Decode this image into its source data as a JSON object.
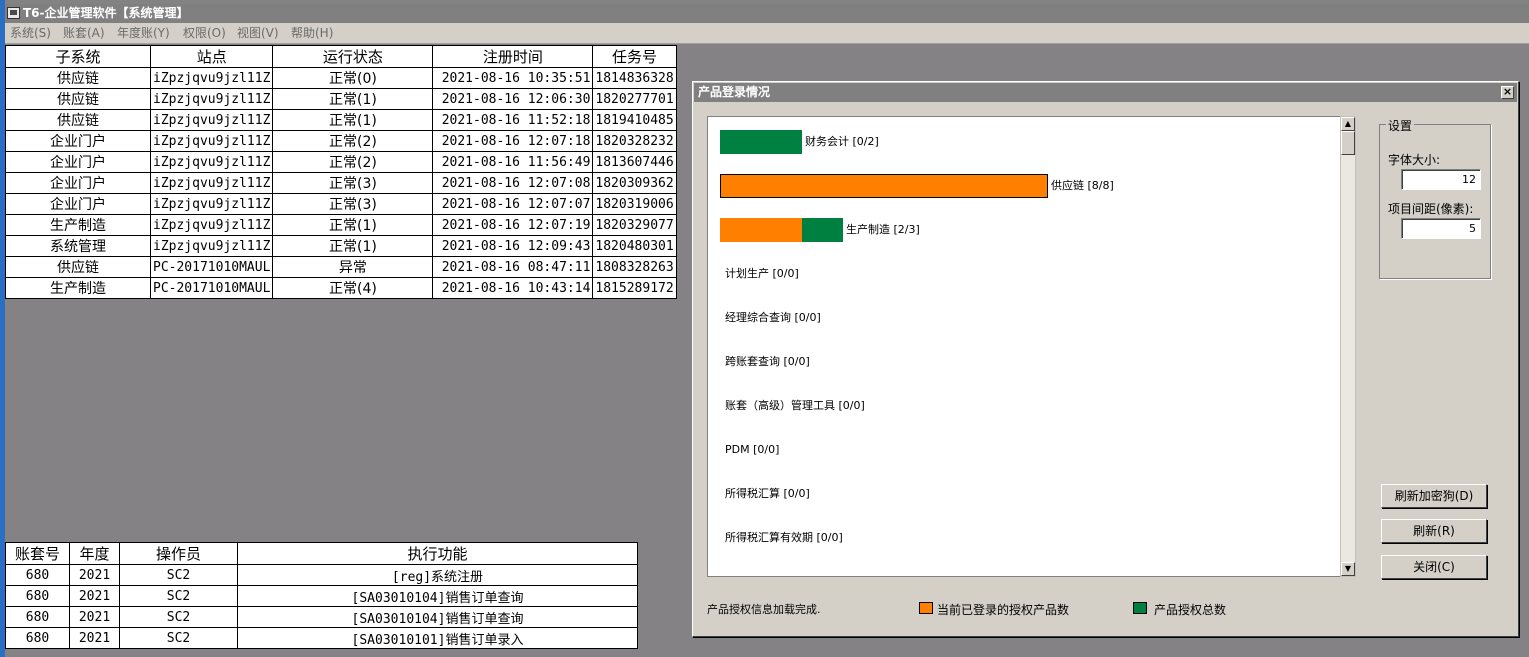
{
  "window": {
    "title": "T6-企业管理软件【系统管理】"
  },
  "menu": [
    "系统(S)",
    "账套(A)",
    "年度账(Y)",
    "权限(O)",
    "视图(V)",
    "帮助(H)"
  ],
  "top_grid": {
    "headers": [
      "子系统",
      "站点",
      "运行状态",
      "注册时间",
      "任务号"
    ],
    "rows": [
      [
        "供应链",
        "iZpzjqvu9jzl11Z",
        "正常(0)",
        "2021-08-16 10:35:51",
        "1814836328"
      ],
      [
        "供应链",
        "iZpzjqvu9jzl11Z",
        "正常(1)",
        "2021-08-16 12:06:30",
        "1820277701"
      ],
      [
        "供应链",
        "iZpzjqvu9jzl11Z",
        "正常(1)",
        "2021-08-16 11:52:18",
        "1819410485"
      ],
      [
        "企业门户",
        "iZpzjqvu9jzl11Z",
        "正常(2)",
        "2021-08-16 12:07:18",
        "1820328232"
      ],
      [
        "企业门户",
        "iZpzjqvu9jzl11Z",
        "正常(2)",
        "2021-08-16 11:56:49",
        "1813607446"
      ],
      [
        "企业门户",
        "iZpzjqvu9jzl11Z",
        "正常(3)",
        "2021-08-16 12:07:08",
        "1820309362"
      ],
      [
        "企业门户",
        "iZpzjqvu9jzl11Z",
        "正常(3)",
        "2021-08-16 12:07:07",
        "1820319006"
      ],
      [
        "生产制造",
        "iZpzjqvu9jzl11Z",
        "正常(1)",
        "2021-08-16 12:07:19",
        "1820329077"
      ],
      [
        "系统管理",
        "iZpzjqvu9jzl11Z",
        "正常(1)",
        "2021-08-16 12:09:43",
        "1820480301"
      ],
      [
        "供应链",
        "PC-20171010MAUL",
        "异常",
        "2021-08-16 08:47:11",
        "1808328263"
      ],
      [
        "生产制造",
        "PC-20171010MAUL",
        "正常(4)",
        "2021-08-16 10:43:14",
        "1815289172"
      ]
    ]
  },
  "bottom_grid": {
    "headers": [
      "账套号",
      "年度",
      "操作员",
      "执行功能"
    ],
    "rows": [
      [
        "680",
        "2021",
        "SC2",
        "[reg]系统注册"
      ],
      [
        "680",
        "2021",
        "SC2",
        "[SA03010104]销售订单查询"
      ],
      [
        "680",
        "2021",
        "SC2",
        "[SA03010104]销售订单查询"
      ],
      [
        "680",
        "2021",
        "SC2",
        "[SA03010101]销售订单录入"
      ]
    ]
  },
  "dialog": {
    "title": "产品登录情况",
    "close_icon": "close-icon",
    "items": [
      {
        "label": "财务会计 [0/2]",
        "logged": 0,
        "total": 2
      },
      {
        "label": "供应链 [8/8]",
        "logged": 8,
        "total": 8
      },
      {
        "label": "生产制造 [2/3]",
        "logged": 2,
        "total": 3
      },
      {
        "label": "计划生产 [0/0]",
        "logged": 0,
        "total": 0
      },
      {
        "label": "经理综合查询 [0/0]",
        "logged": 0,
        "total": 0
      },
      {
        "label": "跨账套查询 [0/0]",
        "logged": 0,
        "total": 0
      },
      {
        "label": "账套（高级）管理工具 [0/0]",
        "logged": 0,
        "total": 0
      },
      {
        "label": "PDM [0/0]",
        "logged": 0,
        "total": 0
      },
      {
        "label": "所得税汇算 [0/0]",
        "logged": 0,
        "total": 0
      },
      {
        "label": "所得税汇算有效期 [0/0]",
        "logged": 0,
        "total": 0
      }
    ],
    "colors": {
      "logged": "#ff8000",
      "total": "#008040"
    },
    "settings": {
      "title": "设置",
      "font_size_label": "字体大小:",
      "font_size_value": "12",
      "spacing_label": "项目间距(像素):",
      "spacing_value": "5"
    },
    "buttons": {
      "refresh_dongle": "刷新加密狗(D)",
      "refresh": "刷新(R)",
      "close": "关闭(C)"
    },
    "status": "产品授权信息加载完成.",
    "legend": {
      "logged": "当前已登录的授权产品数",
      "total": "产品授权总数"
    }
  }
}
